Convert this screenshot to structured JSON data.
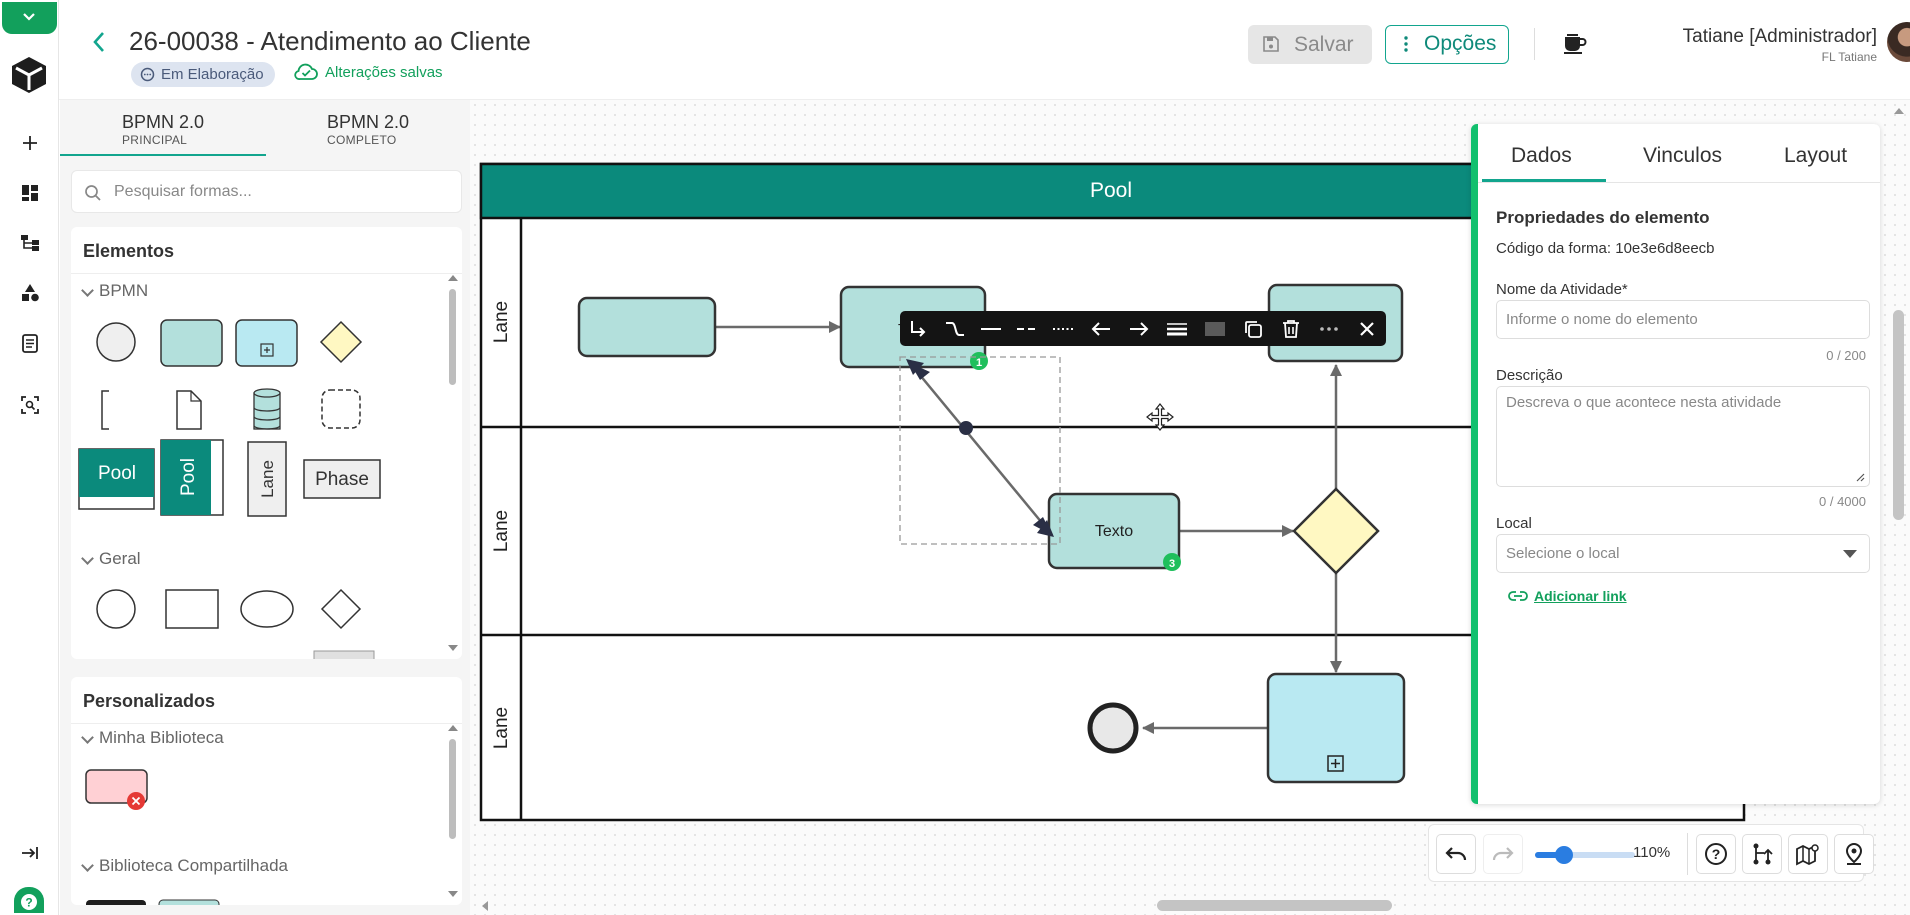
{
  "header": {
    "title": "26-00038 - Atendimento ao Cliente",
    "status": "Em Elaboração",
    "saved_text": "Alterações salvas",
    "save_label": "Salvar",
    "options_label": "Opções",
    "user_name": "Tatiane [Administrador]",
    "user_company": "FL Tatiane"
  },
  "palette": {
    "tabs": [
      {
        "label": "BPMN 2.0",
        "sub": "PRINCIPAL"
      },
      {
        "label": "BPMN 2.0",
        "sub": "COMPLETO"
      }
    ],
    "search_placeholder": "Pesquisar formas...",
    "elements_title": "Elementos",
    "groups": {
      "bpmn": "BPMN",
      "geral": "Geral"
    },
    "shape_labels": {
      "pool_h": "Pool",
      "pool_v": "Pool",
      "lane": "Lane",
      "phase": "Phase"
    },
    "custom_title": "Personalizados",
    "custom_groups": {
      "mine": "Minha Biblioteca",
      "shared": "Biblioteca Compartilhada"
    }
  },
  "diagram": {
    "pool_label": "Pool",
    "lane_labels": [
      "Lane",
      "Lane",
      "Lane"
    ],
    "task_text": "Texto",
    "task_partial": "T",
    "badges": [
      "1",
      "3"
    ]
  },
  "properties": {
    "tabs": [
      "Dados",
      "Vinculos",
      "Layout"
    ],
    "active_tab": "Dados",
    "section_title": "Propriedades do elemento",
    "shape_code_label": "Código da forma:",
    "shape_code": "10e3e6d8eecb",
    "name_label": "Nome da Atividade*",
    "name_placeholder": "Informe o nome do elemento",
    "name_count": "0 / 200",
    "desc_label": "Descrição",
    "desc_placeholder": "Descreva o que acontece nesta atividade",
    "desc_count": "0 / 4000",
    "local_label": "Local",
    "local_placeholder": "Selecione o local",
    "add_link": "Adicionar link"
  },
  "zoom": {
    "label": "110%",
    "level": 0.28
  },
  "colors": {
    "brand_green": "#12a05c",
    "teal": "#0b8a7c",
    "task_fill": "#b3e0dc",
    "subprocess_fill": "#b9e9f2",
    "gateway_fill": "#fff8c2"
  }
}
